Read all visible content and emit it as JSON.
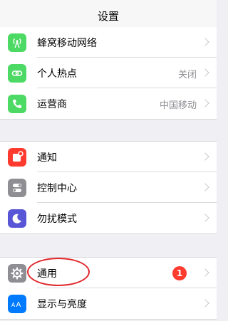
{
  "navbar": {
    "title": "设置"
  },
  "group1": [
    {
      "name": "cellular",
      "label": "蜂窝移动网络",
      "value": "",
      "icon": "antenna-icon",
      "color": "#4cd964"
    },
    {
      "name": "hotspot",
      "label": "个人热点",
      "value": "关闭",
      "icon": "link-icon",
      "color": "#4cd964"
    },
    {
      "name": "carrier",
      "label": "运营商",
      "value": "中国移动",
      "icon": "phone-icon",
      "color": "#4cd964"
    }
  ],
  "group2": [
    {
      "name": "notifications",
      "label": "通知",
      "value": "",
      "icon": "notification-icon",
      "color": "#ff3b30"
    },
    {
      "name": "control-center",
      "label": "控制中心",
      "value": "",
      "icon": "toggles-icon",
      "color": "#8e8e93"
    },
    {
      "name": "do-not-disturb",
      "label": "勿扰模式",
      "value": "",
      "icon": "moon-icon",
      "color": "#5856d6"
    }
  ],
  "group3": [
    {
      "name": "general",
      "label": "通用",
      "value": "",
      "badge": "1",
      "icon": "gear-icon",
      "color": "#8e8e93"
    },
    {
      "name": "display-brightness",
      "label": "显示与亮度",
      "value": "",
      "icon": "text-size-icon",
      "color": "#007aff"
    }
  ]
}
